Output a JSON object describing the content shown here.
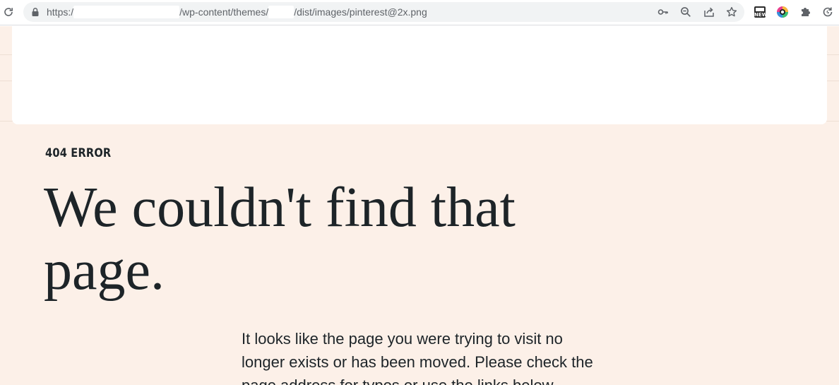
{
  "browser": {
    "url": {
      "scheme": "https:/",
      "part_1": "/wp-content/themes/",
      "part_2": "/dist/images/pinterest@2x.png"
    },
    "extensions": {
      "news_badge": "NEW"
    },
    "colors": {
      "toolbar_bg": "#ffffff",
      "omnibox_bg": "#f1f3f4",
      "icon": "#5f6368"
    }
  },
  "page": {
    "eyebrow": "404 ERROR",
    "headline": "We couldn't find that page.",
    "body": "It looks like the page you were trying to visit no longer exists or has been moved. Please check the page address for typos or use the links below",
    "colors": {
      "background": "#fcf0e8",
      "text": "#1d2428"
    }
  }
}
